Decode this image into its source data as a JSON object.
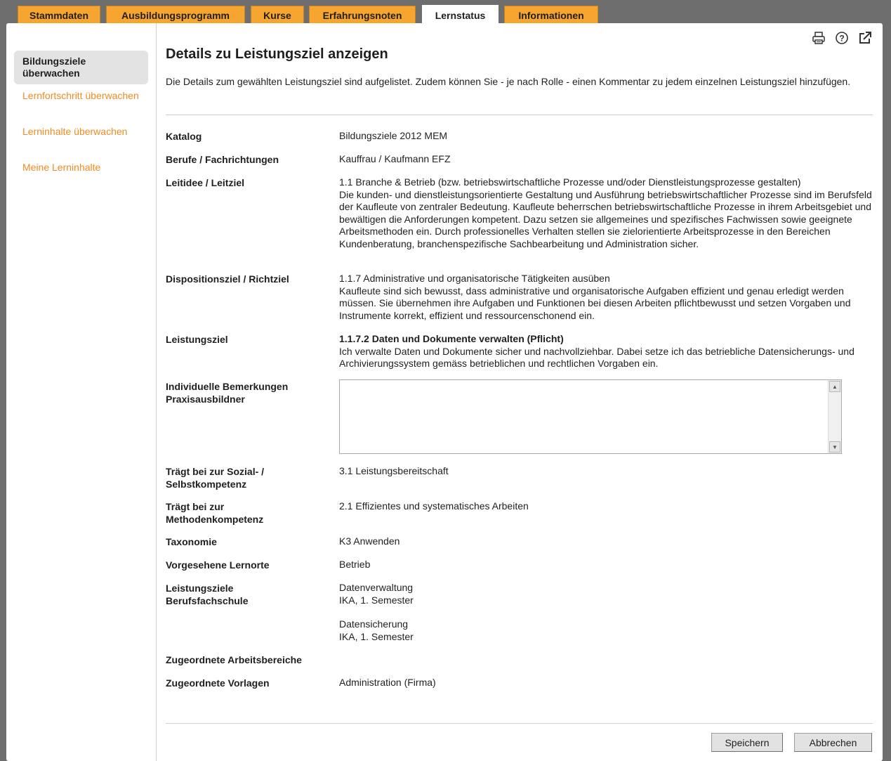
{
  "tabs": [
    {
      "label": "Stammdaten",
      "active": false
    },
    {
      "label": "Ausbildungsprogramm",
      "active": false
    },
    {
      "label": "Kurse",
      "active": false
    },
    {
      "label": "Erfahrungsnoten",
      "active": false
    },
    {
      "label": "Lernstatus",
      "active": true
    },
    {
      "label": "Informationen",
      "active": false
    }
  ],
  "sidebar": {
    "items": [
      {
        "label": "Bildungsziele überwachen",
        "active": true
      },
      {
        "label": "Lernfortschritt überwachen",
        "active": false
      },
      {
        "label": "Lerninhalte überwachen",
        "active": false
      },
      {
        "label": "Meine Lerninhalte",
        "active": false
      }
    ]
  },
  "toolbar": {
    "icons": [
      "print-icon",
      "help-icon",
      "popout-icon"
    ]
  },
  "page": {
    "title": "Details zu Leistungsziel anzeigen",
    "intro": "Die Details zum gewählten Leistungsziel sind aufgelistet. Zudem können Sie - je nach Rolle - einen Kommentar zu jedem einzelnen Leistungsziel hinzufügen."
  },
  "fields": {
    "katalog": {
      "label": "Katalog",
      "value": "Bildungsziele 2012 MEM"
    },
    "berufe": {
      "label": "Berufe / Fachrichtungen",
      "value": "Kauffrau / Kaufmann EFZ"
    },
    "leitidee": {
      "label": "Leitidee / Leitziel",
      "line1": "1.1 Branche & Betrieb (bzw. betriebswirtschaftliche Prozesse und/oder Dienstleistungsprozesse gestalten)",
      "text": "Die kunden- und dienstleistungsorientierte Gestaltung und Ausführung betriebswirtschaftlicher Prozesse sind im Berufsfeld der Kaufleute von zentraler Bedeutung. Kaufleute beherrschen betriebswirtschaftliche Prozesse in ihrem Arbeitsgebiet und bewältigen die Anforderungen kompetent. Dazu setzen sie allgemeines und spezifisches Fachwissen sowie geeignete Arbeitsmethoden ein. Durch professionelles Verhalten stellen sie zielorientierte Arbeitsprozesse in den Bereichen Kundenberatung, branchenspezifische Sachbearbeitung und Administration sicher."
    },
    "disposition": {
      "label": "Dispositionsziel / Richtziel",
      "line1": "1.1.7 Administrative und organisatorische Tätigkeiten ausüben",
      "text": "Kaufleute sind sich bewusst, dass administrative und organisatorische Aufgaben effizient und genau erledigt werden müssen. Sie übernehmen ihre Aufgaben und Funktionen bei diesen Arbeiten pflichtbewusst und setzen Vorgaben und Instrumente korrekt, effizient und ressourcenschonend ein."
    },
    "leistungsziel": {
      "label": "Leistungsziel",
      "heading": "1.1.7.2 Daten und Dokumente verwalten  (Pflicht)",
      "text": "Ich verwalte Daten und Dokumente sicher und nachvollziehbar. Dabei setze ich das betriebliche Datensicherungs- und Archivierungssystem gemäss betrieblichen und rechtlichen Vorgaben ein."
    },
    "bemerkungen": {
      "label_line1": "Individuelle Bemerkungen",
      "label_line2": "Praxisausbildner",
      "value": ""
    },
    "sozial": {
      "label_line1": "Trägt bei zur Sozial- /",
      "label_line2": "Selbstkompetenz",
      "value": "3.1 Leistungsbereitschaft"
    },
    "methoden": {
      "label_line1": "Trägt bei zur",
      "label_line2": "Methodenkompetenz",
      "value": "2.1 Effizientes und systematisches Arbeiten"
    },
    "taxonomie": {
      "label": "Taxonomie",
      "value": "K3 Anwenden"
    },
    "lernorte": {
      "label": "Vorgesehene Lernorte",
      "value": "Betrieb"
    },
    "berufsfachschule": {
      "label_line1": "Leistungsziele",
      "label_line2": "Berufsfachschule",
      "entries": [
        {
          "name": "Datenverwaltung",
          "detail": "IKA, 1. Semester"
        },
        {
          "name": "Datensicherung",
          "detail": "IKA, 1. Semester"
        }
      ]
    },
    "arbeitsbereiche": {
      "label": "Zugeordnete Arbeitsbereiche",
      "value": ""
    },
    "vorlagen": {
      "label": "Zugeordnete Vorlagen",
      "value": "Administration (Firma)"
    }
  },
  "buttons": {
    "save": "Speichern",
    "cancel": "Abbrechen"
  },
  "colors": {
    "tab": "#f7a531",
    "link": "#f28a1e",
    "background": "#6e6e6e"
  }
}
